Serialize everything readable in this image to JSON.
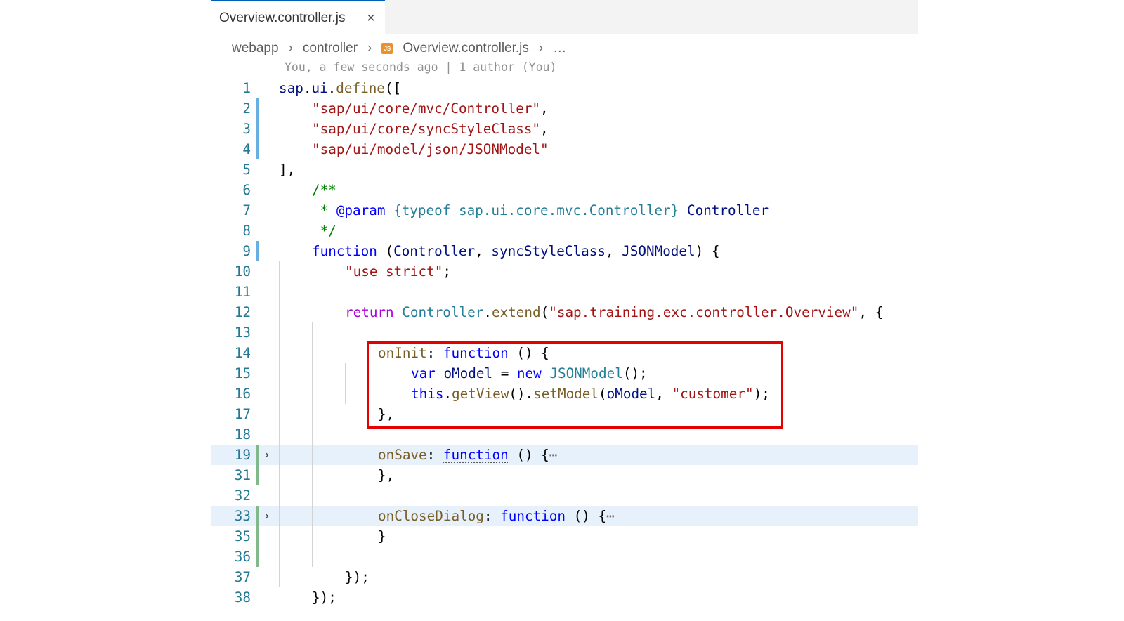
{
  "tab": {
    "label": "Overview.controller.js",
    "close_glyph": "×"
  },
  "breadcrumb": {
    "items": [
      "webapp",
      "controller",
      "Overview.controller.js",
      "…"
    ],
    "separator": "›",
    "file_icon": "js-file-icon",
    "file_icon_text": "JS"
  },
  "blame": "You, a few seconds ago | 1 author (You)",
  "colors": {
    "accent": "#005fb8",
    "highlight_box": "#e60000",
    "gutter_modified": "#66afe0",
    "gutter_added": "#81b88b",
    "folded_line_bg": "#e7f1fc"
  },
  "code_lines": [
    {
      "n": "1",
      "gutter": "",
      "fold": false,
      "indent": 0,
      "tokens": [
        [
          "var",
          "sap"
        ],
        [
          "punc",
          "."
        ],
        [
          "var",
          "ui"
        ],
        [
          "punc",
          "."
        ],
        [
          "fn",
          "define"
        ],
        [
          "punc",
          "(["
        ]
      ]
    },
    {
      "n": "2",
      "gutter": "mod",
      "fold": false,
      "indent": 1,
      "tokens": [
        [
          "str",
          "\"sap/ui/core/mvc/Controller\""
        ],
        [
          "punc",
          ","
        ]
      ]
    },
    {
      "n": "3",
      "gutter": "mod",
      "fold": false,
      "indent": 1,
      "tokens": [
        [
          "str",
          "\"sap/ui/core/syncStyleClass\""
        ],
        [
          "punc",
          ","
        ]
      ]
    },
    {
      "n": "4",
      "gutter": "mod",
      "fold": false,
      "indent": 1,
      "tokens": [
        [
          "str",
          "\"sap/ui/model/json/JSONModel\""
        ]
      ]
    },
    {
      "n": "5",
      "gutter": "",
      "fold": false,
      "indent": 0,
      "tokens": [
        [
          "punc",
          "],"
        ]
      ]
    },
    {
      "n": "6",
      "gutter": "",
      "fold": false,
      "indent": 1,
      "tokens": [
        [
          "cmt",
          "/**"
        ]
      ]
    },
    {
      "n": "7",
      "gutter": "",
      "fold": false,
      "indent": 1,
      "tokens": [
        [
          "cmt",
          " * "
        ],
        [
          "doc",
          "@param"
        ],
        [
          "cmt",
          " "
        ],
        [
          "type",
          "{typeof sap.ui.core.mvc.Controller}"
        ],
        [
          "cmt",
          " "
        ],
        [
          "var",
          "Controller"
        ]
      ]
    },
    {
      "n": "8",
      "gutter": "",
      "fold": false,
      "indent": 1,
      "tokens": [
        [
          "cmt",
          " */"
        ]
      ]
    },
    {
      "n": "9",
      "gutter": "mod",
      "fold": false,
      "indent": 1,
      "tokens": [
        [
          "kw",
          "function"
        ],
        [
          "punc",
          " ("
        ],
        [
          "var",
          "Controller"
        ],
        [
          "punc",
          ", "
        ],
        [
          "var",
          "syncStyleClass"
        ],
        [
          "punc",
          ", "
        ],
        [
          "var",
          "JSONModel"
        ],
        [
          "punc",
          ") {"
        ]
      ]
    },
    {
      "n": "10",
      "gutter": "",
      "fold": false,
      "indent": 2,
      "tokens": [
        [
          "str",
          "\"use strict\""
        ],
        [
          "punc",
          ";"
        ]
      ]
    },
    {
      "n": "11",
      "gutter": "",
      "fold": false,
      "indent": 2,
      "tokens": []
    },
    {
      "n": "12",
      "gutter": "",
      "fold": false,
      "indent": 2,
      "tokens": [
        [
          "ctl",
          "return"
        ],
        [
          "punc",
          " "
        ],
        [
          "type",
          "Controller"
        ],
        [
          "punc",
          "."
        ],
        [
          "fn",
          "extend"
        ],
        [
          "punc",
          "("
        ],
        [
          "str",
          "\"sap.training.exc.controller.Overview\""
        ],
        [
          "punc",
          ", {"
        ]
      ]
    },
    {
      "n": "13",
      "gutter": "",
      "fold": false,
      "indent": 3,
      "tokens": []
    },
    {
      "n": "14",
      "gutter": "",
      "fold": false,
      "indent": 3,
      "tokens": [
        [
          "fn",
          "onInit"
        ],
        [
          "punc",
          ": "
        ],
        [
          "kw",
          "function"
        ],
        [
          "punc",
          " () {"
        ]
      ]
    },
    {
      "n": "15",
      "gutter": "",
      "fold": false,
      "indent": 4,
      "tokens": [
        [
          "kw",
          "var"
        ],
        [
          "punc",
          " "
        ],
        [
          "var",
          "oModel"
        ],
        [
          "punc",
          " = "
        ],
        [
          "kw",
          "new"
        ],
        [
          "punc",
          " "
        ],
        [
          "type",
          "JSONModel"
        ],
        [
          "punc",
          "();"
        ]
      ]
    },
    {
      "n": "16",
      "gutter": "",
      "fold": false,
      "indent": 4,
      "tokens": [
        [
          "kw",
          "this"
        ],
        [
          "punc",
          "."
        ],
        [
          "fn",
          "getView"
        ],
        [
          "punc",
          "()."
        ],
        [
          "fn",
          "setModel"
        ],
        [
          "punc",
          "("
        ],
        [
          "var",
          "oModel"
        ],
        [
          "punc",
          ", "
        ],
        [
          "str",
          "\"customer\""
        ],
        [
          "punc",
          ");"
        ]
      ]
    },
    {
      "n": "17",
      "gutter": "",
      "fold": false,
      "indent": 3,
      "tokens": [
        [
          "punc",
          "},"
        ]
      ]
    },
    {
      "n": "18",
      "gutter": "",
      "fold": false,
      "indent": 3,
      "tokens": []
    },
    {
      "n": "19",
      "gutter": "add",
      "fold": true,
      "indent": 3,
      "tokens": [
        [
          "fn",
          "onSave"
        ],
        [
          "punc",
          ": "
        ],
        [
          "kwsq",
          "function"
        ],
        [
          "punc",
          " () {"
        ],
        [
          "ell",
          "⋯"
        ]
      ]
    },
    {
      "n": "31",
      "gutter": "add",
      "fold": false,
      "indent": 3,
      "tokens": [
        [
          "punc",
          "},"
        ]
      ]
    },
    {
      "n": "32",
      "gutter": "",
      "fold": false,
      "indent": 3,
      "tokens": []
    },
    {
      "n": "33",
      "gutter": "add",
      "fold": true,
      "indent": 3,
      "tokens": [
        [
          "fn",
          "onCloseDialog"
        ],
        [
          "punc",
          ": "
        ],
        [
          "kw",
          "function"
        ],
        [
          "punc",
          " () {"
        ],
        [
          "ell",
          "⋯"
        ]
      ]
    },
    {
      "n": "35",
      "gutter": "add",
      "fold": false,
      "indent": 3,
      "tokens": [
        [
          "punc",
          "}"
        ]
      ]
    },
    {
      "n": "36",
      "gutter": "add",
      "fold": false,
      "indent": 3,
      "tokens": []
    },
    {
      "n": "37",
      "gutter": "",
      "fold": false,
      "indent": 2,
      "tokens": [
        [
          "punc",
          "});"
        ]
      ]
    },
    {
      "n": "38",
      "gutter": "",
      "fold": false,
      "indent": 1,
      "tokens": [
        [
          "punc",
          "});"
        ]
      ]
    }
  ]
}
